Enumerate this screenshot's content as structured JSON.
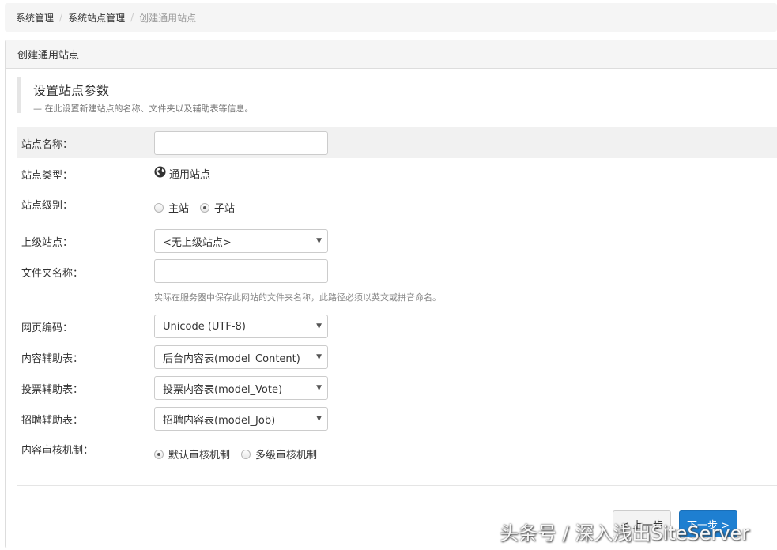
{
  "breadcrumb": {
    "items": [
      "系统管理",
      "系统站点管理",
      "创建通用站点"
    ],
    "separator": "/"
  },
  "panel": {
    "title": "创建通用站点"
  },
  "callout": {
    "title": "设置站点参数",
    "description": "— 在此设置新建站点的名称、文件夹以及辅助表等信息。"
  },
  "form": {
    "site_name": {
      "label": "站点名称：",
      "value": ""
    },
    "site_type": {
      "label": "站点类型：",
      "value": "通用站点",
      "icon": "globe-icon"
    },
    "site_level": {
      "label": "站点级别：",
      "options": [
        "主站",
        "子站"
      ],
      "selected": "子站"
    },
    "parent_site": {
      "label": "上级站点：",
      "value": "<无上级站点>"
    },
    "folder_name": {
      "label": "文件夹名称：",
      "value": "",
      "help": "实际在服务器中保存此网站的文件夹名称，此路径必须以英文或拼音命名。"
    },
    "charset": {
      "label": "网页编码：",
      "value": "Unicode (UTF-8)"
    },
    "content_table": {
      "label": "内容辅助表：",
      "value": "后台内容表(model_Content)"
    },
    "vote_table": {
      "label": "投票辅助表：",
      "value": "投票内容表(model_Vote)"
    },
    "job_table": {
      "label": "招聘辅助表：",
      "value": "招聘内容表(model_Job)"
    },
    "audit": {
      "label": "内容审核机制：",
      "options": [
        "默认审核机制",
        "多级审核机制"
      ],
      "selected": "默认审核机制"
    }
  },
  "buttons": {
    "prev": "< 上一步",
    "next": "下一步 >"
  },
  "watermark": "头条号 / 深入浅出SiteServer",
  "colors": {
    "primary": "#1e7fd1",
    "shaded_row": "#f1f1f1"
  }
}
